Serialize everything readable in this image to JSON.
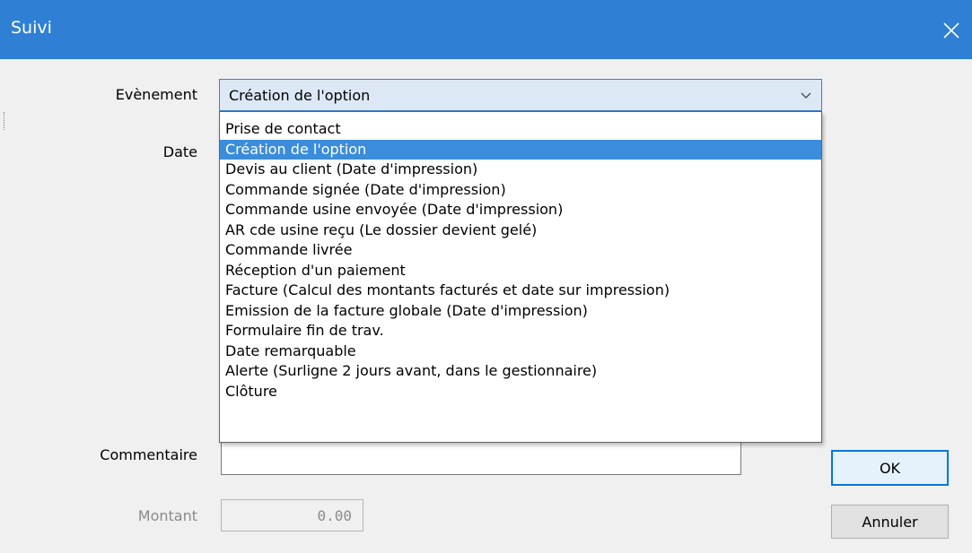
{
  "window": {
    "title": "Suivi",
    "close_icon": "close-icon"
  },
  "form": {
    "event_label": "Evènement",
    "date_label": "Date",
    "comment_label": "Commentaire",
    "amount_label": "Montant",
    "event_value": "Création de l'option",
    "comment_value": "",
    "amount_value": "0.00"
  },
  "dropdown": {
    "selected_index": 1,
    "items": [
      "Prise de contact",
      "Création de l'option",
      "Devis au client  (Date d'impression)",
      "Commande signée  (Date d'impression)",
      "Commande usine envoyée  (Date d'impression)",
      "AR cde usine reçu  (Le dossier devient gelé)",
      "Commande livrée",
      "Réception d'un paiement",
      "Facture  (Calcul des montants facturés et date sur impression)",
      "Emission de la facture globale  (Date d'impression)",
      "Formulaire fin de trav.",
      "Date remarquable",
      "Alerte  (Surligne 2 jours avant, dans le gestionnaire)",
      "Clôture"
    ]
  },
  "buttons": {
    "ok": "OK",
    "cancel": "Annuler"
  },
  "colors": {
    "titlebar": "#2f80d4",
    "selection": "#3b8ddb",
    "focus_border": "#0078d7"
  }
}
